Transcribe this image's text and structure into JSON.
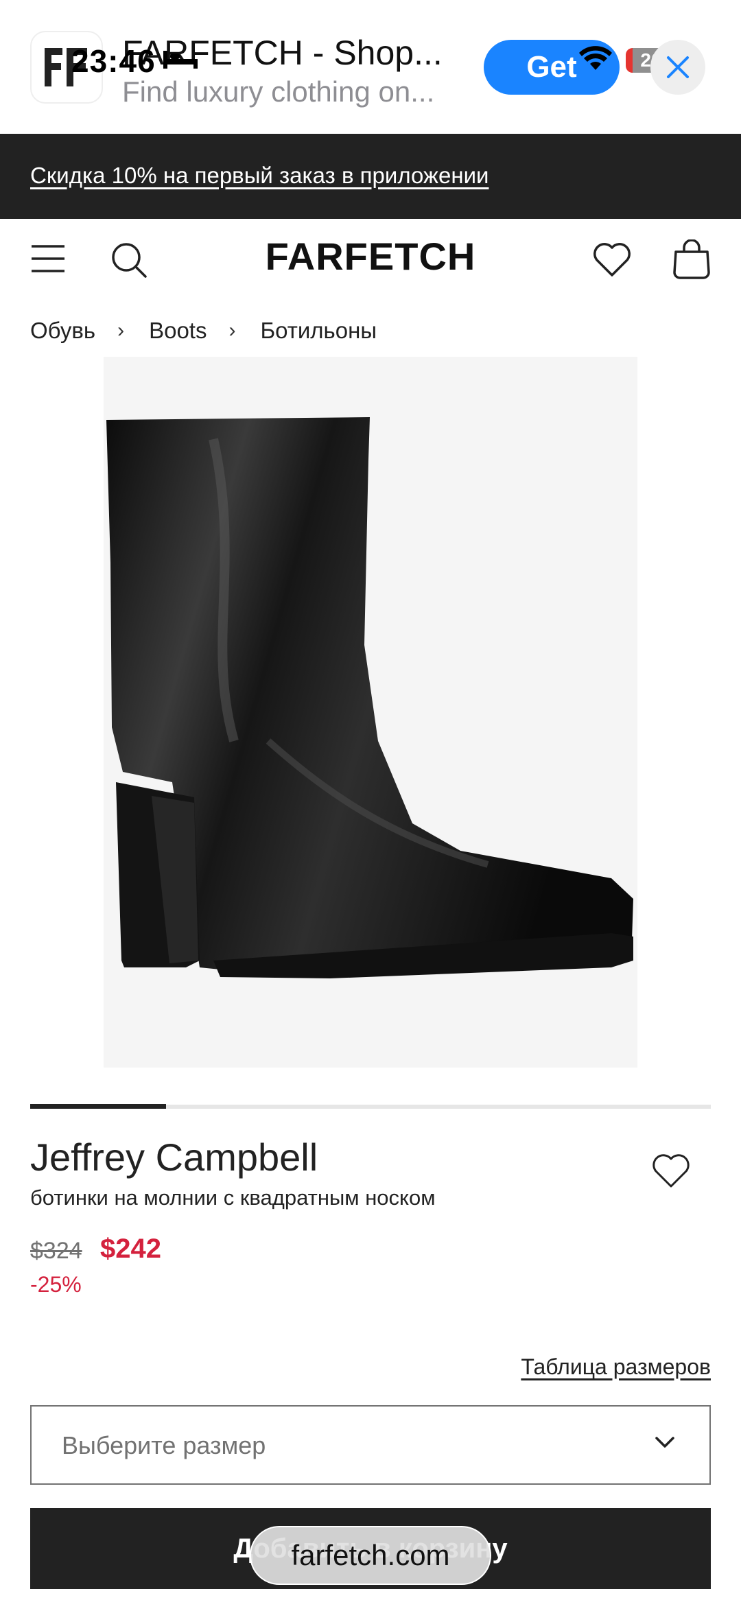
{
  "status_bar": {
    "time": "23:46",
    "battery": "20"
  },
  "app_banner": {
    "title": "FARFETCH - Shop...",
    "subtitle": "Find luxury clothing on...",
    "get_label": "Get"
  },
  "promo": {
    "text": "Скидка 10% на первый заказ в приложении"
  },
  "header": {
    "logo": "FARFETCH"
  },
  "breadcrumb": {
    "items": [
      "Обувь",
      "Boots",
      "Ботильоны"
    ],
    "separator": "›"
  },
  "carousel": {
    "active_index": 0,
    "progress": 0.2
  },
  "product": {
    "brand": "Jeffrey Campbell",
    "description": "ботинки на молнии с квадратным носком",
    "old_price": "$324",
    "price": "$242",
    "discount": "-25%",
    "size_guide_label": "Таблица размеров",
    "size_placeholder": "Выберите размер",
    "add_to_bag_label": "Добавить в корзину"
  },
  "browser": {
    "url": "farfetch.com"
  },
  "colors": {
    "accent_sale": "#d4213d",
    "promo_bg": "#222222",
    "get_button": "#1a84ff"
  }
}
